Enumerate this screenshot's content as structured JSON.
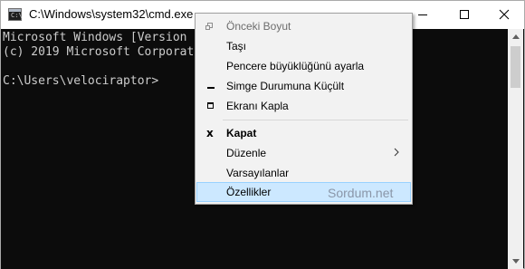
{
  "window": {
    "title": "C:\\Windows\\system32\\cmd.exe",
    "icon_text": "C:\\"
  },
  "console": {
    "lines": [
      "Microsoft Windows [Version",
      "(c) 2019 Microsoft Corporat",
      "C:\\Users\\velociraptor>"
    ],
    "background": "#0c0c0c",
    "foreground": "#cccccc"
  },
  "menu": {
    "items": [
      {
        "label": "Önceki Boyut",
        "icon": "restore-icon",
        "state": "disabled"
      },
      {
        "label": "Taşı"
      },
      {
        "label": "Pencere büyüklüğünü ayarla"
      },
      {
        "label": "Simge Durumuna Küçült",
        "icon": "minimize-icon"
      },
      {
        "label": "Ekranı Kapla",
        "icon": "maximize-icon"
      },
      {
        "label": "Kapat",
        "icon": "close-icon",
        "bold": true
      },
      {
        "label": "Düzenle",
        "submenu": true
      },
      {
        "label": "Varsayılanlar"
      },
      {
        "label": "Özellikler",
        "selected": true
      }
    ],
    "watermark": "Sordum.net",
    "highlight_color": "#cce8ff"
  }
}
